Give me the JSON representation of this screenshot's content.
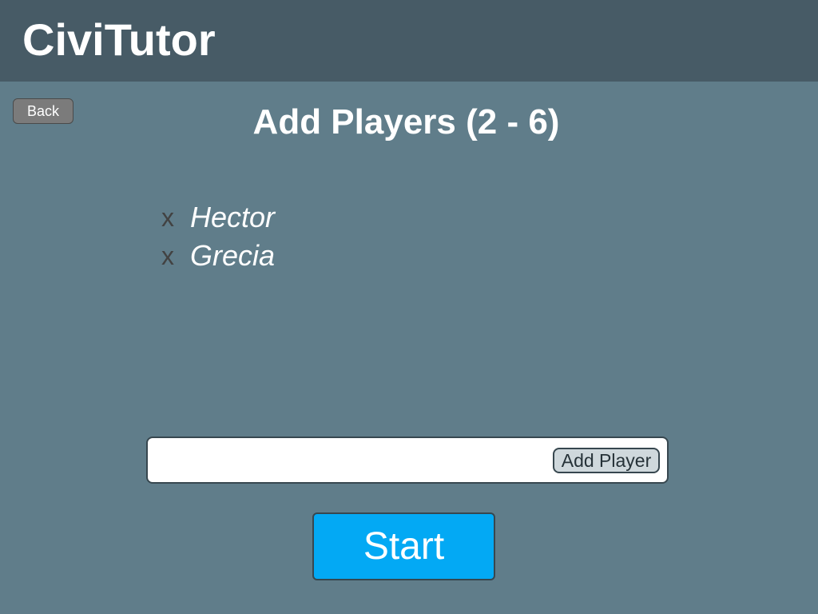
{
  "header": {
    "app_title": "CiviTutor"
  },
  "navigation": {
    "back_label": "Back"
  },
  "page": {
    "heading": "Add Players (2 - 6)"
  },
  "players": [
    {
      "remove_icon": "x",
      "name": "Hector"
    },
    {
      "remove_icon": "x",
      "name": "Grecia"
    }
  ],
  "add_player_form": {
    "input_value": "",
    "input_placeholder": "",
    "button_label": "Add Player"
  },
  "actions": {
    "start_label": "Start"
  },
  "colors": {
    "topbar": "#475b66",
    "background": "#607d8a",
    "start_button": "#03a9f4",
    "back_button": "#7b7b7b",
    "add_button": "#cfd8dc"
  }
}
